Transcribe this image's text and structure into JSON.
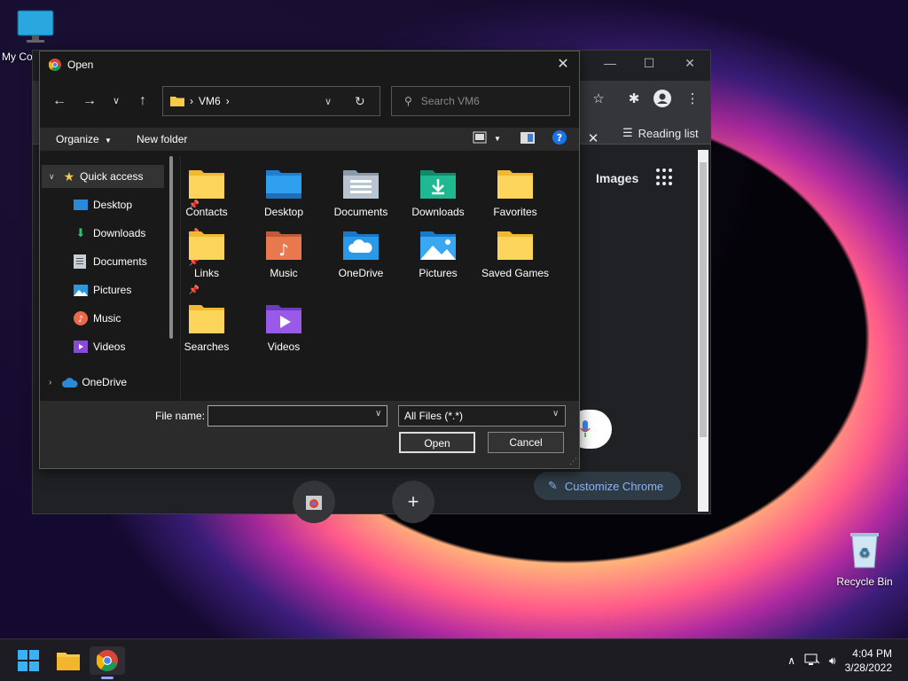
{
  "desktop": {
    "icons": [
      {
        "label": "My Co"
      },
      {
        "label": "Recycle Bin"
      }
    ]
  },
  "chrome": {
    "reading_list": "Reading list",
    "images_link": "Images",
    "customize": "Customize Chrome"
  },
  "dialog": {
    "title": "Open",
    "address_path": "VM6",
    "search_placeholder": "Search VM6",
    "organize": "Organize",
    "new_folder": "New folder",
    "nav": [
      {
        "label": "Quick access",
        "pinned": false
      },
      {
        "label": "Desktop",
        "pinned": true
      },
      {
        "label": "Downloads",
        "pinned": true
      },
      {
        "label": "Documents",
        "pinned": true
      },
      {
        "label": "Pictures",
        "pinned": true
      },
      {
        "label": "Music",
        "pinned": false
      },
      {
        "label": "Videos",
        "pinned": false
      },
      {
        "label": "OneDrive",
        "pinned": false
      }
    ],
    "items": [
      {
        "label": "Contacts",
        "icon": "folder-icon"
      },
      {
        "label": "Desktop",
        "icon": "desktop-folder-icon"
      },
      {
        "label": "Documents",
        "icon": "documents-folder-icon"
      },
      {
        "label": "Downloads",
        "icon": "downloads-folder-icon"
      },
      {
        "label": "Favorites",
        "icon": "folder-icon"
      },
      {
        "label": "Links",
        "icon": "folder-icon"
      },
      {
        "label": "Music",
        "icon": "music-folder-icon"
      },
      {
        "label": "OneDrive",
        "icon": "onedrive-folder-icon"
      },
      {
        "label": "Pictures",
        "icon": "pictures-folder-icon"
      },
      {
        "label": "Saved Games",
        "icon": "folder-icon"
      },
      {
        "label": "Searches",
        "icon": "folder-icon"
      },
      {
        "label": "Videos",
        "icon": "videos-folder-icon"
      }
    ],
    "file_name_label": "File name:",
    "file_name_value": "",
    "file_type": "All Files (*.*)",
    "open_button": "Open",
    "cancel_button": "Cancel"
  },
  "taskbar": {
    "time": "4:04 PM",
    "date": "3/28/2022"
  }
}
